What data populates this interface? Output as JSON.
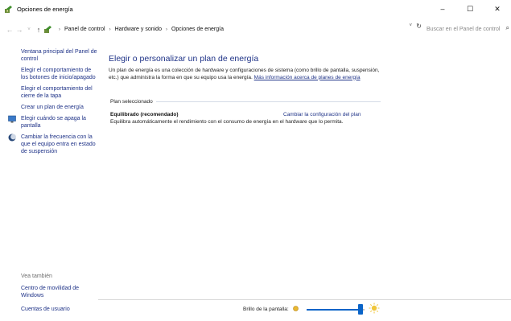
{
  "window": {
    "title": "Opciones de energía",
    "controls": {
      "minimize": "–",
      "maximize": "☐",
      "close": "✕"
    }
  },
  "address": {
    "back": "←",
    "forward": "→",
    "recent": "˅",
    "up": "↑",
    "crumbs": [
      "Panel de control",
      "Hardware y sonido",
      "Opciones de energía"
    ],
    "separator": "›",
    "dropdown": "˅",
    "refresh": "↻"
  },
  "search": {
    "placeholder": "Buscar en el Panel de control",
    "icon": "⌕"
  },
  "sidebar": {
    "items": [
      {
        "label": "Ventana principal del Panel de control",
        "icon": ""
      },
      {
        "label": "Elegir el comportamiento de los botones de inicio/apagado",
        "icon": ""
      },
      {
        "label": "Elegir el comportamiento del cierre de la tapa",
        "icon": ""
      },
      {
        "label": "Crear un plan de energía",
        "icon": ""
      },
      {
        "label": "Elegir cuándo se apaga la pantalla",
        "icon": "monitor-icon"
      },
      {
        "label": "Cambiar la frecuencia con la que el equipo entra en estado de suspensión",
        "icon": "moon-icon"
      }
    ],
    "see_also": "Vea también",
    "bottom_links": [
      "Centro de movilidad de Windows",
      "Cuentas de usuario"
    ]
  },
  "main": {
    "title": "Elegir o personalizar un plan de energía",
    "description": "Un plan de energía es una colección de hardware y configuraciones de sistema (como brillo de pantalla, suspensión, etc.) que administra la forma en que su equipo usa la energía.",
    "more_info_link": "Más información acerca de planes de energía",
    "plan_section_header": "Plan seleccionado",
    "plan_name": "Equilibrado (recomendado)",
    "plan_change_link": "Cambiar la configuración del plan",
    "plan_description": "Equilibra automáticamente el rendimiento con el consumo de energía en el hardware que lo permita."
  },
  "brightness": {
    "label": "Brillo de la pantalla:",
    "level": 0.91
  },
  "colors": {
    "link": "#1e3287",
    "accent": "#0a64c8"
  }
}
